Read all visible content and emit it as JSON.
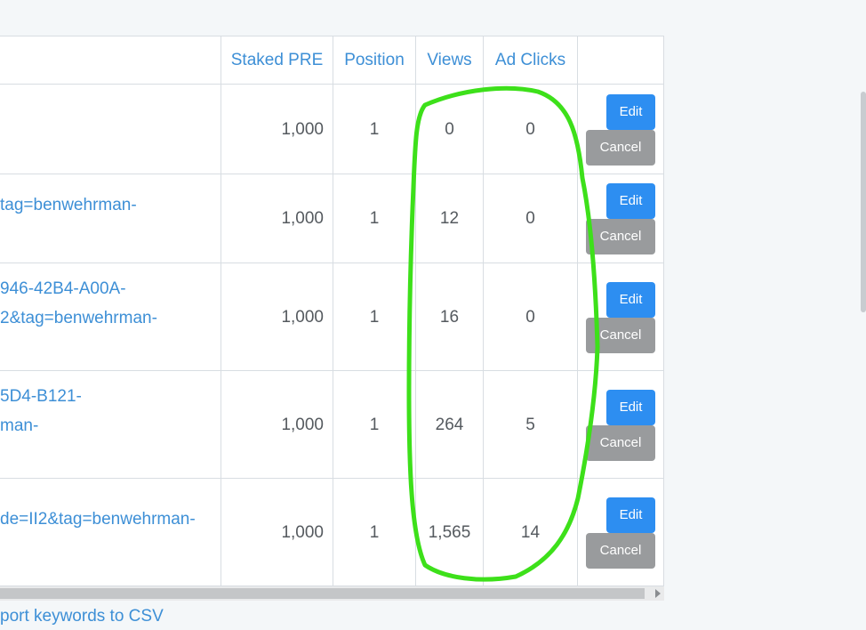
{
  "table": {
    "headers": {
      "staked_pre": "Staked PRE",
      "position": "Position",
      "views": "Views",
      "ad_clicks": "Ad Clicks"
    },
    "rows": [
      {
        "url_lines": [
          "",
          ""
        ],
        "staked_pre": "1,000",
        "position": "1",
        "views": "0",
        "ad_clicks": "0"
      },
      {
        "url_lines": [
          "tag=benwehrman-",
          ""
        ],
        "staked_pre": "1,000",
        "position": "1",
        "views": "12",
        "ad_clicks": "0"
      },
      {
        "url_lines": [
          "946-42B4-A00A-",
          "2&tag=benwehrman-"
        ],
        "staked_pre": "1,000",
        "position": "1",
        "views": "16",
        "ad_clicks": "0"
      },
      {
        "url_lines": [
          "5D4-B121-",
          "man-"
        ],
        "staked_pre": "1,000",
        "position": "1",
        "views": "264",
        "ad_clicks": "5"
      },
      {
        "url_lines": [
          "de=II2&tag=benwehrman-",
          ""
        ],
        "staked_pre": "1,000",
        "position": "1",
        "views": "1,565",
        "ad_clicks": "14"
      }
    ],
    "actions": {
      "edit_label": "Edit",
      "cancel_label": "Cancel"
    }
  },
  "footer": {
    "export_link": "port keywords to CSV"
  },
  "colors": {
    "link": "#3d8fd6",
    "edit": "#2d8ef1",
    "cancel": "#999b9d",
    "annotation": "#3de01a"
  }
}
